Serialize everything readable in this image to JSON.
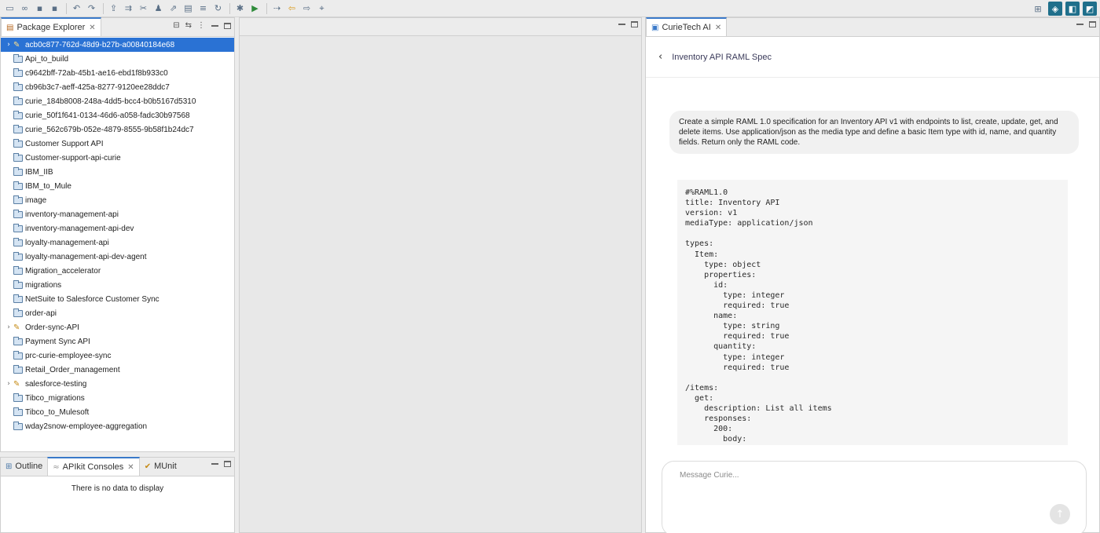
{
  "toolbar": {
    "left_icons": [
      "new-icon",
      "link-icon",
      "save-icon",
      "save-all-icon",
      "undo-icon",
      "redo-icon",
      "publish-icon",
      "deploy-icon",
      "tool-icon",
      "user-icon",
      "share-icon",
      "doc-icon",
      "layers-icon",
      "refresh-icon",
      "debug-icon",
      "run-icon",
      "nav-icon",
      "back-icon",
      "forward-icon",
      "pin-icon"
    ],
    "right_icons": [
      "perspective-icon",
      "mule-perspective-icon",
      "anypoint-icon",
      "studio-icon"
    ]
  },
  "package_explorer": {
    "tab_label": "Package Explorer",
    "items": [
      {
        "label": "acb0c877-762d-48d9-b27b-a00840184e68",
        "type": "mule",
        "expandable": true,
        "selected": true
      },
      {
        "label": "Api_to_build",
        "type": "folder"
      },
      {
        "label": "c9642bff-72ab-45b1-ae16-ebd1f8b933c0",
        "type": "folder"
      },
      {
        "label": "cb96b3c7-aeff-425a-8277-9120ee28ddc7",
        "type": "folder"
      },
      {
        "label": "curie_184b8008-248a-4dd5-bcc4-b0b5167d5310",
        "type": "folder"
      },
      {
        "label": "curie_50f1f641-0134-46d6-a058-fadc30b97568",
        "type": "folder"
      },
      {
        "label": "curie_562c679b-052e-4879-8555-9b58f1b24dc7",
        "type": "folder"
      },
      {
        "label": "Customer Support API",
        "type": "folder"
      },
      {
        "label": "Customer-support-api-curie",
        "type": "folder"
      },
      {
        "label": "IBM_IIB",
        "type": "folder"
      },
      {
        "label": "IBM_to_Mule",
        "type": "folder"
      },
      {
        "label": "image",
        "type": "folder"
      },
      {
        "label": "inventory-management-api",
        "type": "folder"
      },
      {
        "label": "inventory-management-api-dev",
        "type": "folder"
      },
      {
        "label": "loyalty-management-api",
        "type": "folder"
      },
      {
        "label": "loyalty-management-api-dev-agent",
        "type": "folder"
      },
      {
        "label": "Migration_accelerator",
        "type": "folder"
      },
      {
        "label": "migrations",
        "type": "folder"
      },
      {
        "label": "NetSuite to Salesforce Customer Sync",
        "type": "folder"
      },
      {
        "label": "order-api",
        "type": "folder"
      },
      {
        "label": "Order-sync-API",
        "type": "mule",
        "expandable": true
      },
      {
        "label": "Payment Sync API",
        "type": "folder"
      },
      {
        "label": "prc-curie-employee-sync",
        "type": "folder"
      },
      {
        "label": "Retail_Order_management",
        "type": "folder"
      },
      {
        "label": "salesforce-testing",
        "type": "mule",
        "expandable": true
      },
      {
        "label": "Tibco_migrations",
        "type": "folder"
      },
      {
        "label": "Tibco_to_Mulesoft",
        "type": "folder"
      },
      {
        "label": "wday2snow-employee-aggregation",
        "type": "folder"
      }
    ]
  },
  "bottom_panel": {
    "tabs": [
      {
        "label": "Outline",
        "active": false
      },
      {
        "label": "APIkit Consoles",
        "active": true
      },
      {
        "label": "MUnit",
        "active": false
      }
    ],
    "empty_text": "There is no data to display"
  },
  "curie": {
    "tab_label": "CurieTech AI",
    "title": "Inventory API RAML Spec",
    "user_message": "Create a simple RAML 1.0 specification for an Inventory API v1 with endpoints to list, create, update, get, and delete items. Use application/json as the media type and define a basic Item type with id, name, and quantity fields. Return only the RAML code.",
    "code": "#%RAML1.0\ntitle: Inventory API\nversion: v1\nmediaType: application/json\n\ntypes:\n  Item:\n    type: object\n    properties:\n      id:\n        type: integer\n        required: true\n      name:\n        type: string\n        required: true\n      quantity:\n        type: integer\n        required: true\n\n/items:\n  get:\n    description: List all items\n    responses:\n      200:\n        body:",
    "input_placeholder": "Message Curie..."
  }
}
